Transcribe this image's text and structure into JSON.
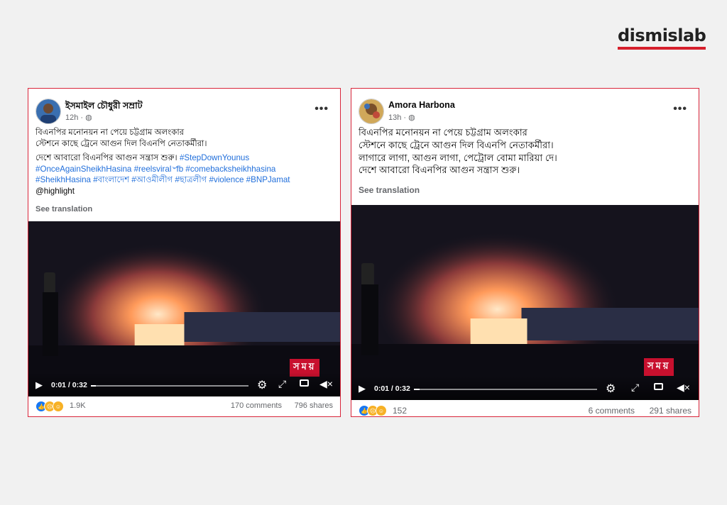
{
  "brand": {
    "logo_text": "dismislab",
    "accent": "#d61f2c"
  },
  "posts": [
    {
      "author": "ইসমাইল চৌধুরী সম্রাট",
      "time": "12h",
      "more": "•••",
      "lines": [
        "বিএনপির মনোনয়ন না পেয়ে চট্টগ্রাম অলংকার",
        "স্টেশনে কাছে ট্রেনে আগুন দিল বিএনপি নেতাকর্মীরা।"
      ],
      "text2": "দেশে আবারো বিএনপির আগুন সন্ত্রাস শুরু। ",
      "hashtag_line1": "#StepDownYounus",
      "hashtag_line2": "#OnceAgainSheikhHasina #reelsviral৺fb #comebacksheikhhasina",
      "hashtag_line3": "#SheikhHasina #বাংলাদেশ #আওমীলীগ #ছাত্রলীগ #violence #BNPJamat",
      "mention": "@highlight",
      "see_translation": "See translation",
      "video": {
        "time": "0:01 / 0:32",
        "progress": 0.03,
        "watermark": "সময়"
      },
      "reactions": {
        "count": "1.9K",
        "comments": "170 comments",
        "shares": "796 shares"
      }
    },
    {
      "author": "Amora Harbona",
      "time": "13h",
      "more": "•••",
      "lines": [
        "বিএনপির মনোনয়ন না পেয়ে চট্টগ্রাম অলংকার",
        "স্টেশনে কাছে ট্রেনে আগুন দিল বিএনপি নেতাকর্মীরা।",
        "লাগারে লাগা, আগুন লাগা, পেট্রোল বোমা মারিয়া দে।",
        "দেশে আবারো বিএনপির আগুন সন্ত্রাস শুরু।"
      ],
      "see_translation": "See translation",
      "video": {
        "time": "0:01 / 0:32",
        "progress": 0.03,
        "watermark": "সময়"
      },
      "reactions": {
        "count": "152",
        "comments": "6 comments",
        "shares": "291 shares"
      }
    }
  ],
  "icons": [
    "globe-icon",
    "play-icon",
    "settings-icon",
    "fullscreen-icon",
    "pip-icon",
    "volume-icon",
    "like-icon",
    "sad-icon",
    "haha-icon"
  ]
}
